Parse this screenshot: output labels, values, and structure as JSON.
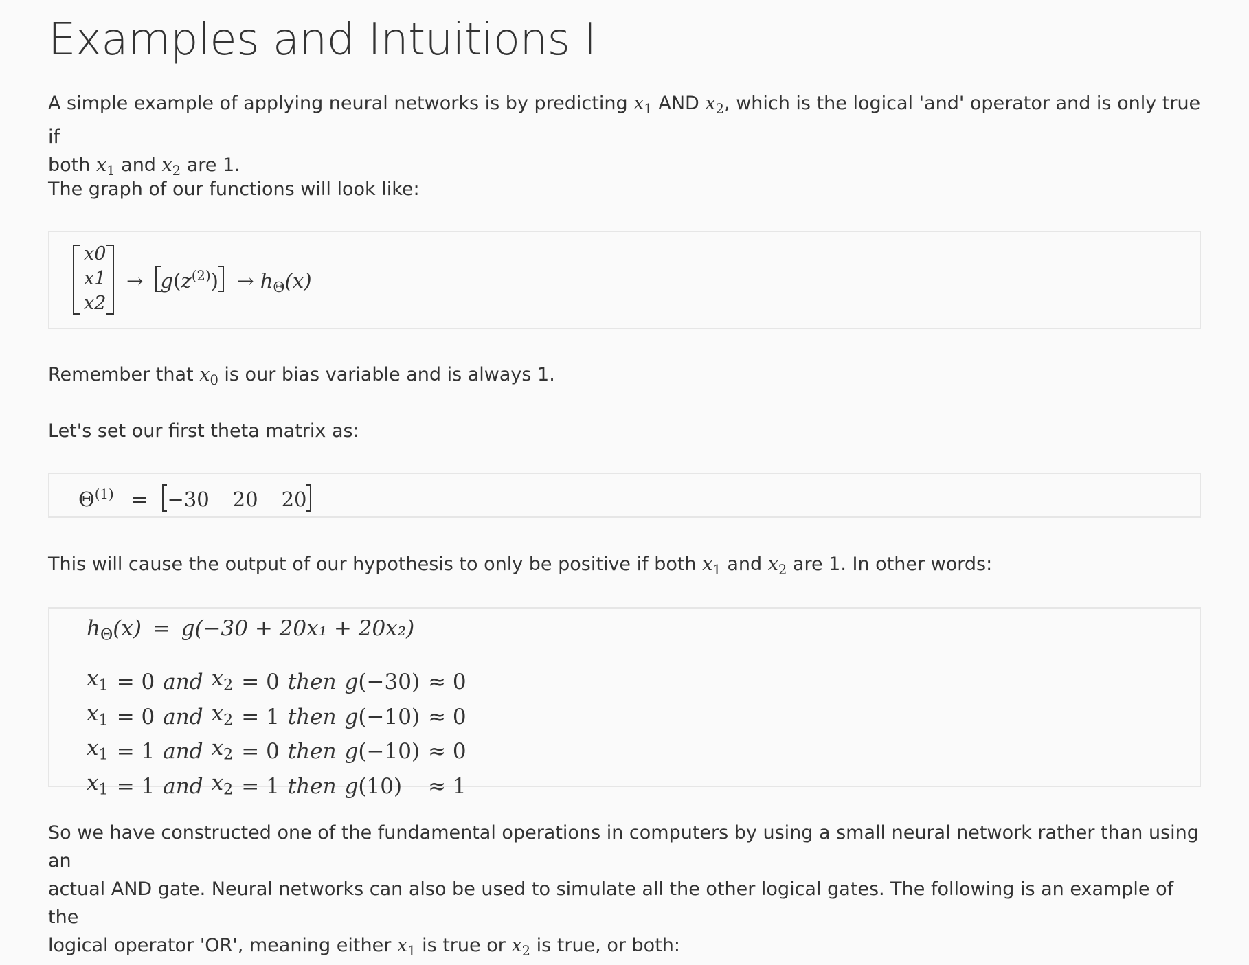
{
  "title": "Examples and Intuitions I",
  "intro": {
    "t1": "A simple example of applying neural networks is by predicting ",
    "x1": "x",
    "x1_sub": "1",
    "and_word": " AND ",
    "x2": "x",
    "x2_sub": "2",
    "t2": ", which is the logical 'and' operator and is only true if",
    "t3": "both ",
    "t4": " and ",
    "t5": " are 1."
  },
  "graph_intro": "The graph of our functions will look like:",
  "graph_formula": {
    "vector": [
      "x0",
      "x1",
      "x2"
    ],
    "arrow": "→",
    "g": "g",
    "z": "z",
    "z_sup": "(2)",
    "h": "h",
    "h_sub": "Θ",
    "x_arg": "(x)"
  },
  "bias_note": {
    "t1": "Remember that ",
    "sym": "x",
    "sub": "0",
    "t2": " is our bias variable and is always 1."
  },
  "theta_intro": "Let's set our first theta matrix as:",
  "theta_formula": {
    "lhs": "Θ",
    "lhs_sup": "(1)",
    "eq": "=",
    "values": [
      "−30",
      "20",
      "20"
    ]
  },
  "hypothesis_note": {
    "t1": "This will cause the output of our hypothesis to only be positive if both ",
    "t2": " and ",
    "t3": " are 1. In other words:"
  },
  "hypothesis_formula": {
    "main": "g(−30 + 20x₁ + 20x₂)",
    "rows": [
      {
        "x1": "0",
        "x2": "0",
        "arg": "−30",
        "approx": "0"
      },
      {
        "x1": "0",
        "x2": "1",
        "arg": "−10",
        "approx": "0"
      },
      {
        "x1": "1",
        "x2": "0",
        "arg": "−10",
        "approx": "0"
      },
      {
        "x1": "1",
        "x2": "1",
        "arg": "10",
        "approx": "1"
      }
    ],
    "and_word": "and",
    "then_word": "then"
  },
  "closing": {
    "l1": "So we have constructed one of the fundamental operations in computers by using a small neural network rather than using an",
    "l2": "actual AND gate. Neural networks can also be used to simulate all the other logical gates. The following is an example of the",
    "l3a": "logical operator 'OR', meaning either ",
    "l3b": " is true or ",
    "l3c": " is true, or both:"
  }
}
